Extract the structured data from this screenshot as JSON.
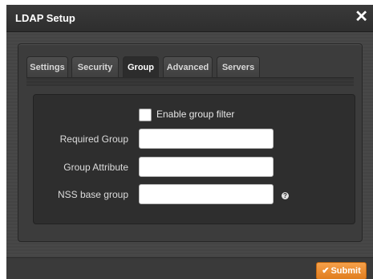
{
  "dialog": {
    "title": "LDAP Setup",
    "close_glyph": "✕"
  },
  "tabs": [
    {
      "label": "Settings",
      "active": false
    },
    {
      "label": "Security",
      "active": false
    },
    {
      "label": "Group",
      "active": true
    },
    {
      "label": "Advanced",
      "active": false
    },
    {
      "label": "Servers",
      "active": false
    }
  ],
  "group": {
    "enable_filter": {
      "label": "Enable group filter",
      "checked": false
    },
    "required_group": {
      "label": "Required Group",
      "value": ""
    },
    "group_attribute": {
      "label": "Group Attribute",
      "value": ""
    },
    "nss_base_group": {
      "label": "NSS base group",
      "value": ""
    },
    "help_glyph": "?"
  },
  "footer": {
    "submit_label": "Submit",
    "submit_icon": "check-icon"
  },
  "colors": {
    "accent": "#f0902f",
    "background": "#3b3b3b"
  }
}
